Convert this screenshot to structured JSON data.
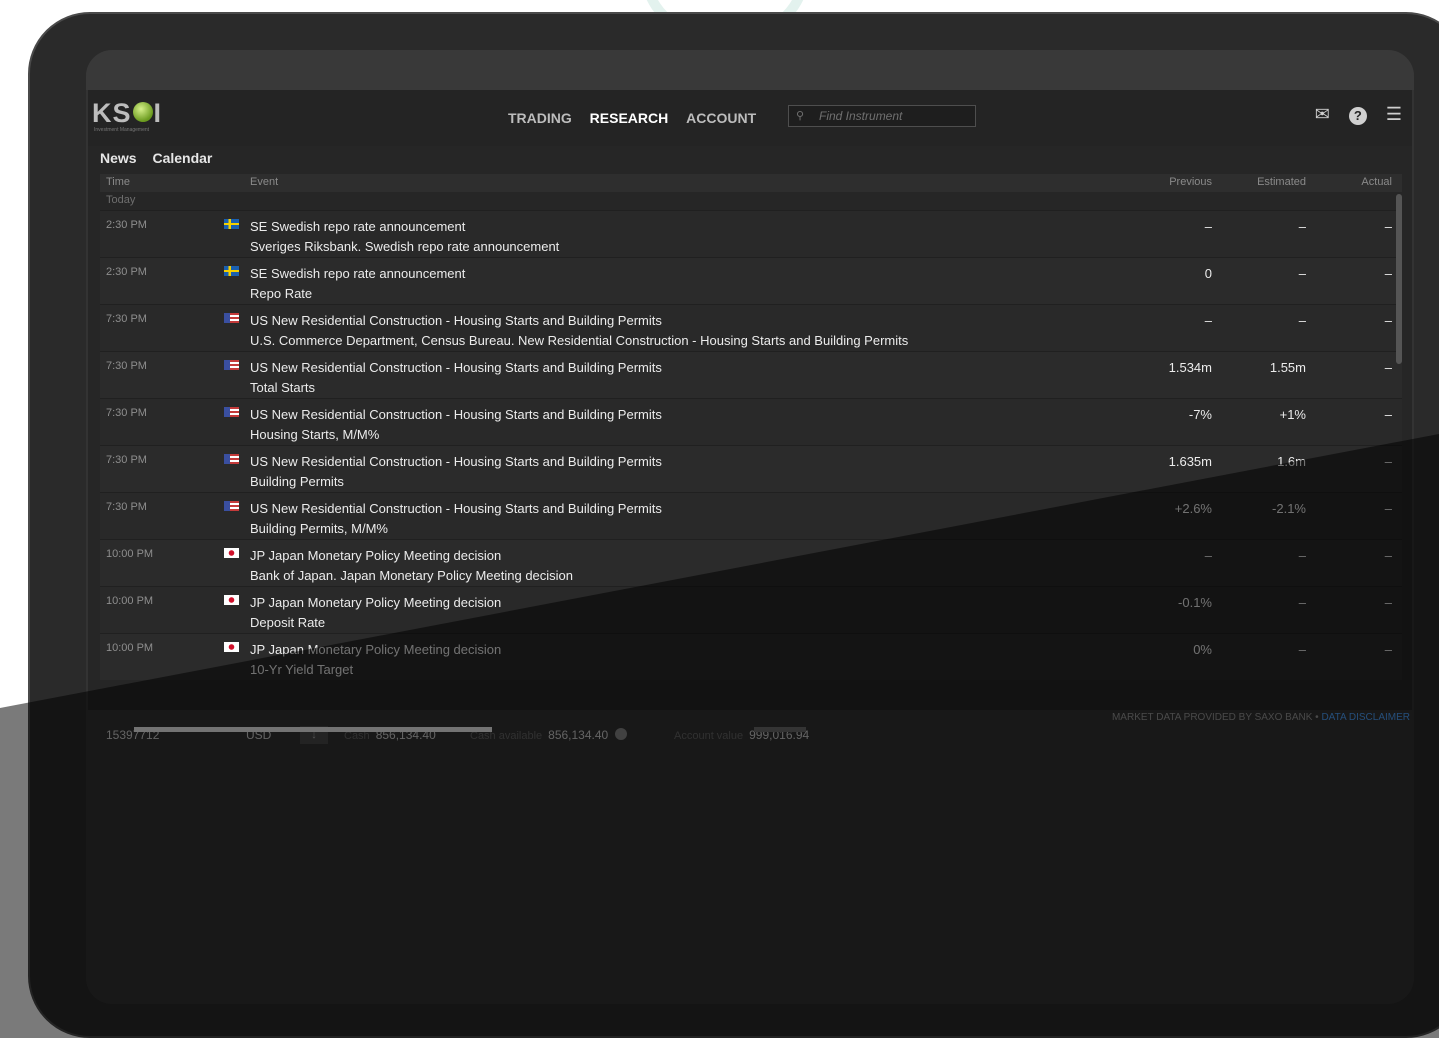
{
  "logo": {
    "text_a": "KS",
    "text_b": "I",
    "subtitle": "Investment Management"
  },
  "nav": {
    "menu": [
      "TRADING",
      "RESEARCH",
      "ACCOUNT"
    ],
    "active": "RESEARCH",
    "search_placeholder": "Find Instrument",
    "search_icon": "search-icon",
    "icons": [
      "mail-icon",
      "help-icon",
      "menu-icon"
    ]
  },
  "subtabs": [
    "News",
    "Calendar"
  ],
  "table": {
    "headers": {
      "time": "Time",
      "event": "Event",
      "previous": "Previous",
      "estimated": "Estimated",
      "actual": "Actual"
    },
    "group": "Today",
    "rows": [
      {
        "time": "2:30 PM",
        "country": "SE",
        "title": "SE Swedish repo rate announcement",
        "detail": "Sveriges Riksbank. Swedish repo rate announcement",
        "previous": "–",
        "estimated": "–",
        "actual": "–"
      },
      {
        "time": "2:30 PM",
        "country": "SE",
        "title": "SE Swedish repo rate announcement",
        "detail": "Repo Rate",
        "previous": "0",
        "estimated": "–",
        "actual": "–"
      },
      {
        "time": "7:30 PM",
        "country": "US",
        "title": "US New Residential Construction - Housing Starts and Building Permits",
        "detail": "U.S. Commerce Department, Census Bureau. New Residential Construction - Housing Starts and Building Permits",
        "previous": "–",
        "estimated": "–",
        "actual": "–"
      },
      {
        "time": "7:30 PM",
        "country": "US",
        "title": "US New Residential Construction - Housing Starts and Building Permits",
        "detail": "Total Starts",
        "previous": "1.534m",
        "estimated": "1.55m",
        "actual": "–"
      },
      {
        "time": "7:30 PM",
        "country": "US",
        "title": "US New Residential Construction - Housing Starts and Building Permits",
        "detail": "Housing Starts, M/M%",
        "previous": "-7%",
        "estimated": "+1%",
        "actual": "–"
      },
      {
        "time": "7:30 PM",
        "country": "US",
        "title": "US New Residential Construction - Housing Starts and Building Permits",
        "detail": "Building Permits",
        "previous": "1.635m",
        "estimated": "1.6m",
        "actual": "–"
      },
      {
        "time": "7:30 PM",
        "country": "US",
        "title": "US New Residential Construction - Housing Starts and Building Permits",
        "detail": "Building Permits, M/M%",
        "previous": "+2.6%",
        "estimated": "-2.1%",
        "actual": "–"
      },
      {
        "time": "10:00 PM",
        "country": "JP",
        "title": "JP Japan Monetary Policy Meeting decision",
        "detail": "Bank of Japan. Japan Monetary Policy Meeting decision",
        "previous": "–",
        "estimated": "–",
        "actual": "–"
      },
      {
        "time": "10:00 PM",
        "country": "JP",
        "title": "JP Japan Monetary Policy Meeting decision",
        "detail": "Deposit Rate",
        "previous": "-0.1%",
        "estimated": "–",
        "actual": "–"
      },
      {
        "time": "10:00 PM",
        "country": "JP",
        "title": "JP Japan Monetary Policy Meeting decision",
        "detail": "10-Yr Yield Target",
        "previous": "0%",
        "estimated": "–",
        "actual": "–"
      }
    ]
  },
  "footer": {
    "account": "15397712",
    "currency": "USD",
    "download_icon": "download-icon",
    "cash_label": "Cash",
    "cash": "856,134.40",
    "cash_available_label": "Cash available",
    "cash_available": "856,134.40",
    "info_icon": "info-icon",
    "account_value_label": "Account value",
    "account_value": "999,016.94"
  },
  "disclaimer": {
    "text": "MARKET DATA PROVIDED BY SAXO BANK • ",
    "link": "DATA DISCLAIMER"
  }
}
